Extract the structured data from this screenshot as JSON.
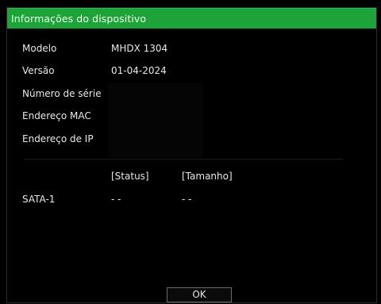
{
  "dialog": {
    "title": "Informações do dispositivo"
  },
  "info": {
    "model_label": "Modelo",
    "model_value": "MHDX 1304",
    "version_label": "Versão",
    "version_value": "01-04-2024",
    "serial_label": "Número de série",
    "serial_value": "",
    "mac_label": "Endereço MAC",
    "mac_value": "",
    "ip_label": "Endereço de IP",
    "ip_value": ""
  },
  "disks": {
    "status_header": "[Status]",
    "size_header": "[Tamanho]",
    "rows": [
      {
        "name": "SATA-1",
        "status": "- -",
        "size": "- -"
      }
    ]
  },
  "footer": {
    "ok_label": "OK"
  },
  "colors": {
    "title_bar": "#1ea33a",
    "background": "#000000",
    "text": "#e8e8e8"
  }
}
